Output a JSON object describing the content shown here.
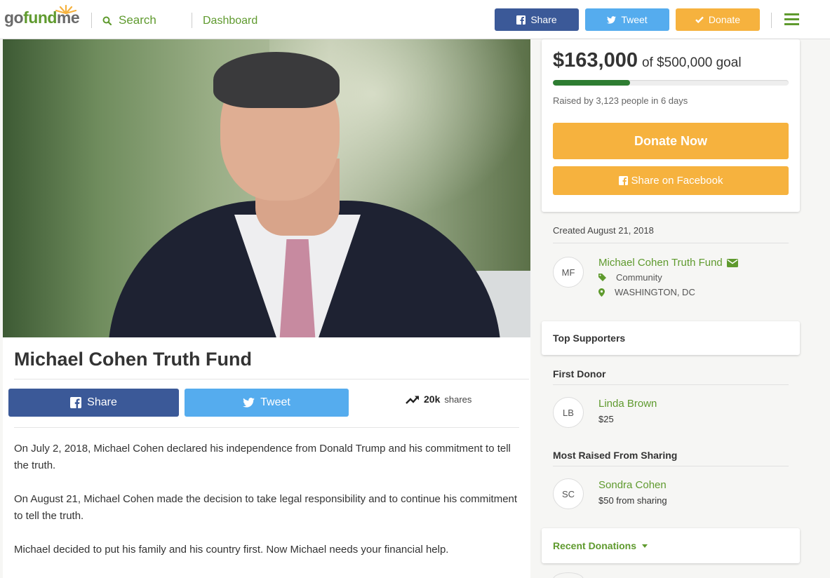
{
  "header": {
    "logo_prefix": "go",
    "logo_fund": "fund",
    "logo_suffix": "me",
    "search_label": "Search",
    "dashboard_label": "Dashboard",
    "share_label": "Share",
    "tweet_label": "Tweet",
    "donate_label": "Donate"
  },
  "campaign": {
    "title": "Michael Cohen Truth Fund",
    "share_button": "Share",
    "tweet_button": "Tweet",
    "shares_count": "20k",
    "shares_label": "shares",
    "story": [
      "On July 2, 2018, Michael Cohen declared his independence from Donald Trump and his commitment to tell the truth.",
      "On August 21, Michael Cohen made the decision to take legal responsibility and to continue his commitment to tell the truth.",
      "Michael decided to put his family and his country first.  Now Michael needs your financial help."
    ]
  },
  "donation": {
    "raised": "$163,000",
    "goal_text": "of $500,000 goal",
    "progress_fraction": 0.326,
    "raised_by": "Raised by 3,123 people in 6 days",
    "donate_now": "Donate Now",
    "share_facebook": "Share on Facebook"
  },
  "organizer": {
    "created": "Created August 21, 2018",
    "initials": "MF",
    "name": "Michael Cohen Truth Fund",
    "category": "Community",
    "location": "WASHINGTON, DC"
  },
  "supporters": {
    "heading": "Top Supporters",
    "first_donor_heading": "First Donor",
    "first_donor": {
      "initials": "LB",
      "name": "Linda Brown",
      "amount": "$25"
    },
    "most_raised_heading": "Most Raised From Sharing",
    "most_raised": {
      "initials": "SC",
      "name": "Sondra Cohen",
      "amount": "$50 from sharing"
    }
  },
  "recent": {
    "label": "Recent Donations"
  },
  "colors": {
    "brand_green": "#5f9a2e",
    "facebook": "#3b5998",
    "twitter": "#55acee",
    "donate_orange": "#f6b23e",
    "progress_green": "#2e7d32"
  }
}
